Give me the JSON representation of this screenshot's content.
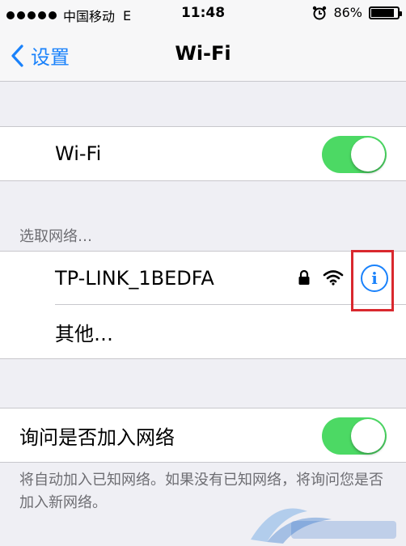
{
  "status_bar": {
    "carrier": "中国移动",
    "network": "E",
    "time": "11:48",
    "battery_percent": "86%",
    "battery_level": 0.86
  },
  "nav": {
    "back_label": "设置",
    "title": "Wi-Fi"
  },
  "wifi_toggle": {
    "label": "Wi-Fi",
    "on": true
  },
  "networks": {
    "header": "选取网络…",
    "items": [
      {
        "name": "TP-LINK_1BEDFA",
        "secured": true
      },
      {
        "name": "其他…"
      }
    ]
  },
  "ask_join": {
    "label": "询问是否加入网络",
    "on": true,
    "footer": "将自动加入已知网络。如果没有已知网络，将询问您是否加入新网络。"
  },
  "colors": {
    "accent": "#1a82fb",
    "switch_on": "#4cd964",
    "highlight": "#d9282e",
    "background": "#efeff4"
  },
  "icons": [
    "chevron-left-icon",
    "alarm-clock-icon",
    "battery-icon",
    "lock-icon",
    "wifi-signal-icon",
    "info-icon"
  ]
}
